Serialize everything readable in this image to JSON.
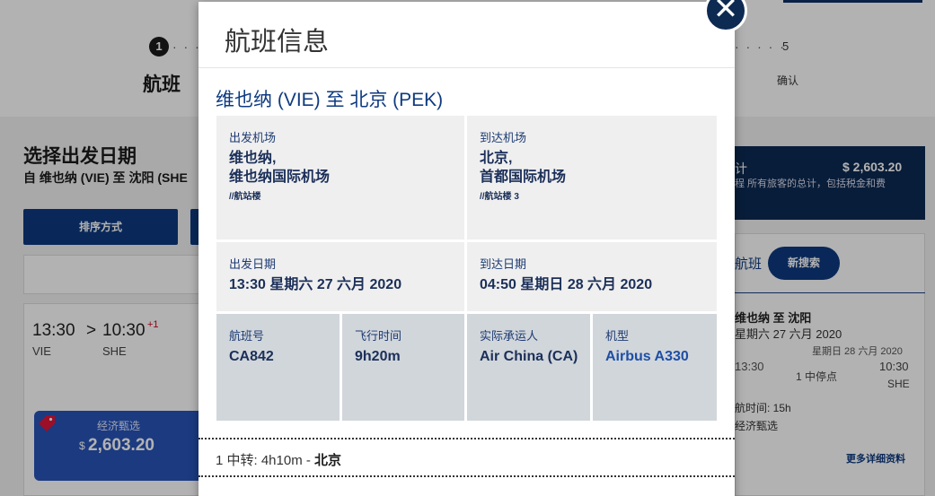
{
  "stepper": {
    "step1_number": "1",
    "step1_label": "航班",
    "step5_number": "5",
    "step5_label": "确认"
  },
  "results": {
    "title": "选择出发日期",
    "route": "自 维也纳 (VIE) 至 沈阳 (SHE",
    "sort_label": "排序方式",
    "flight": {
      "dep_time": "13:30",
      "arrow": ">",
      "arr_time": "10:30",
      "day_offset": "+1",
      "dep_code": "VIE",
      "arr_code": "SHE"
    },
    "fare": {
      "class": "经济甄选",
      "currency": "$",
      "price": "2,603.20"
    }
  },
  "summary": {
    "label": "计",
    "price": "$ 2,603.20",
    "desc": "程 所有旅客的总计，包括税金和费"
  },
  "sidebar": {
    "tab_label": "航班",
    "new_search": "新搜索",
    "route": "维也纳 至 沈阳",
    "date": "星期六 27 六月 2020",
    "arr_date": "星期日 28 六月 2020",
    "dep_time": "13:30",
    "stops": "1 中停点",
    "arr_time": "10:30",
    "arr_code": "SHE",
    "duration": "航时间: 15h",
    "cabin": "经济甄选",
    "more": "更多详细资料"
  },
  "modal": {
    "title": "航班信息",
    "close_glyph": "✕",
    "route_title": "维也纳 (VIE) 至 北京 (PEK)",
    "departure_airport": {
      "label": "出发机场",
      "city": "维也纳,",
      "name": "维也纳国际机场",
      "terminal": "//航站楼"
    },
    "arrival_airport": {
      "label": "到达机场",
      "city": "北京,",
      "name": "首都国际机场",
      "terminal": "//航站楼 3"
    },
    "departure_date": {
      "label": "出发日期",
      "value": "13:30 星期六 27 六月 2020"
    },
    "arrival_date": {
      "label": "到达日期",
      "value": "04:50 星期日 28 六月 2020"
    },
    "flight_number": {
      "label": "航班号",
      "value": "CA842"
    },
    "flight_time": {
      "label": "飞行时间",
      "value": "9h20m"
    },
    "carrier": {
      "label": "实际承运人",
      "value": "Air China (CA)"
    },
    "aircraft": {
      "label": "机型",
      "value": "Airbus A330"
    },
    "transit": {
      "prefix": "1 中转: 4h10m - ",
      "city": "北京"
    }
  },
  "colors": {
    "brand_navy": "#0c2a52",
    "brand_blue": "#0e3a80",
    "fare_blue": "#2853b8",
    "accent_red": "#d0021b"
  }
}
